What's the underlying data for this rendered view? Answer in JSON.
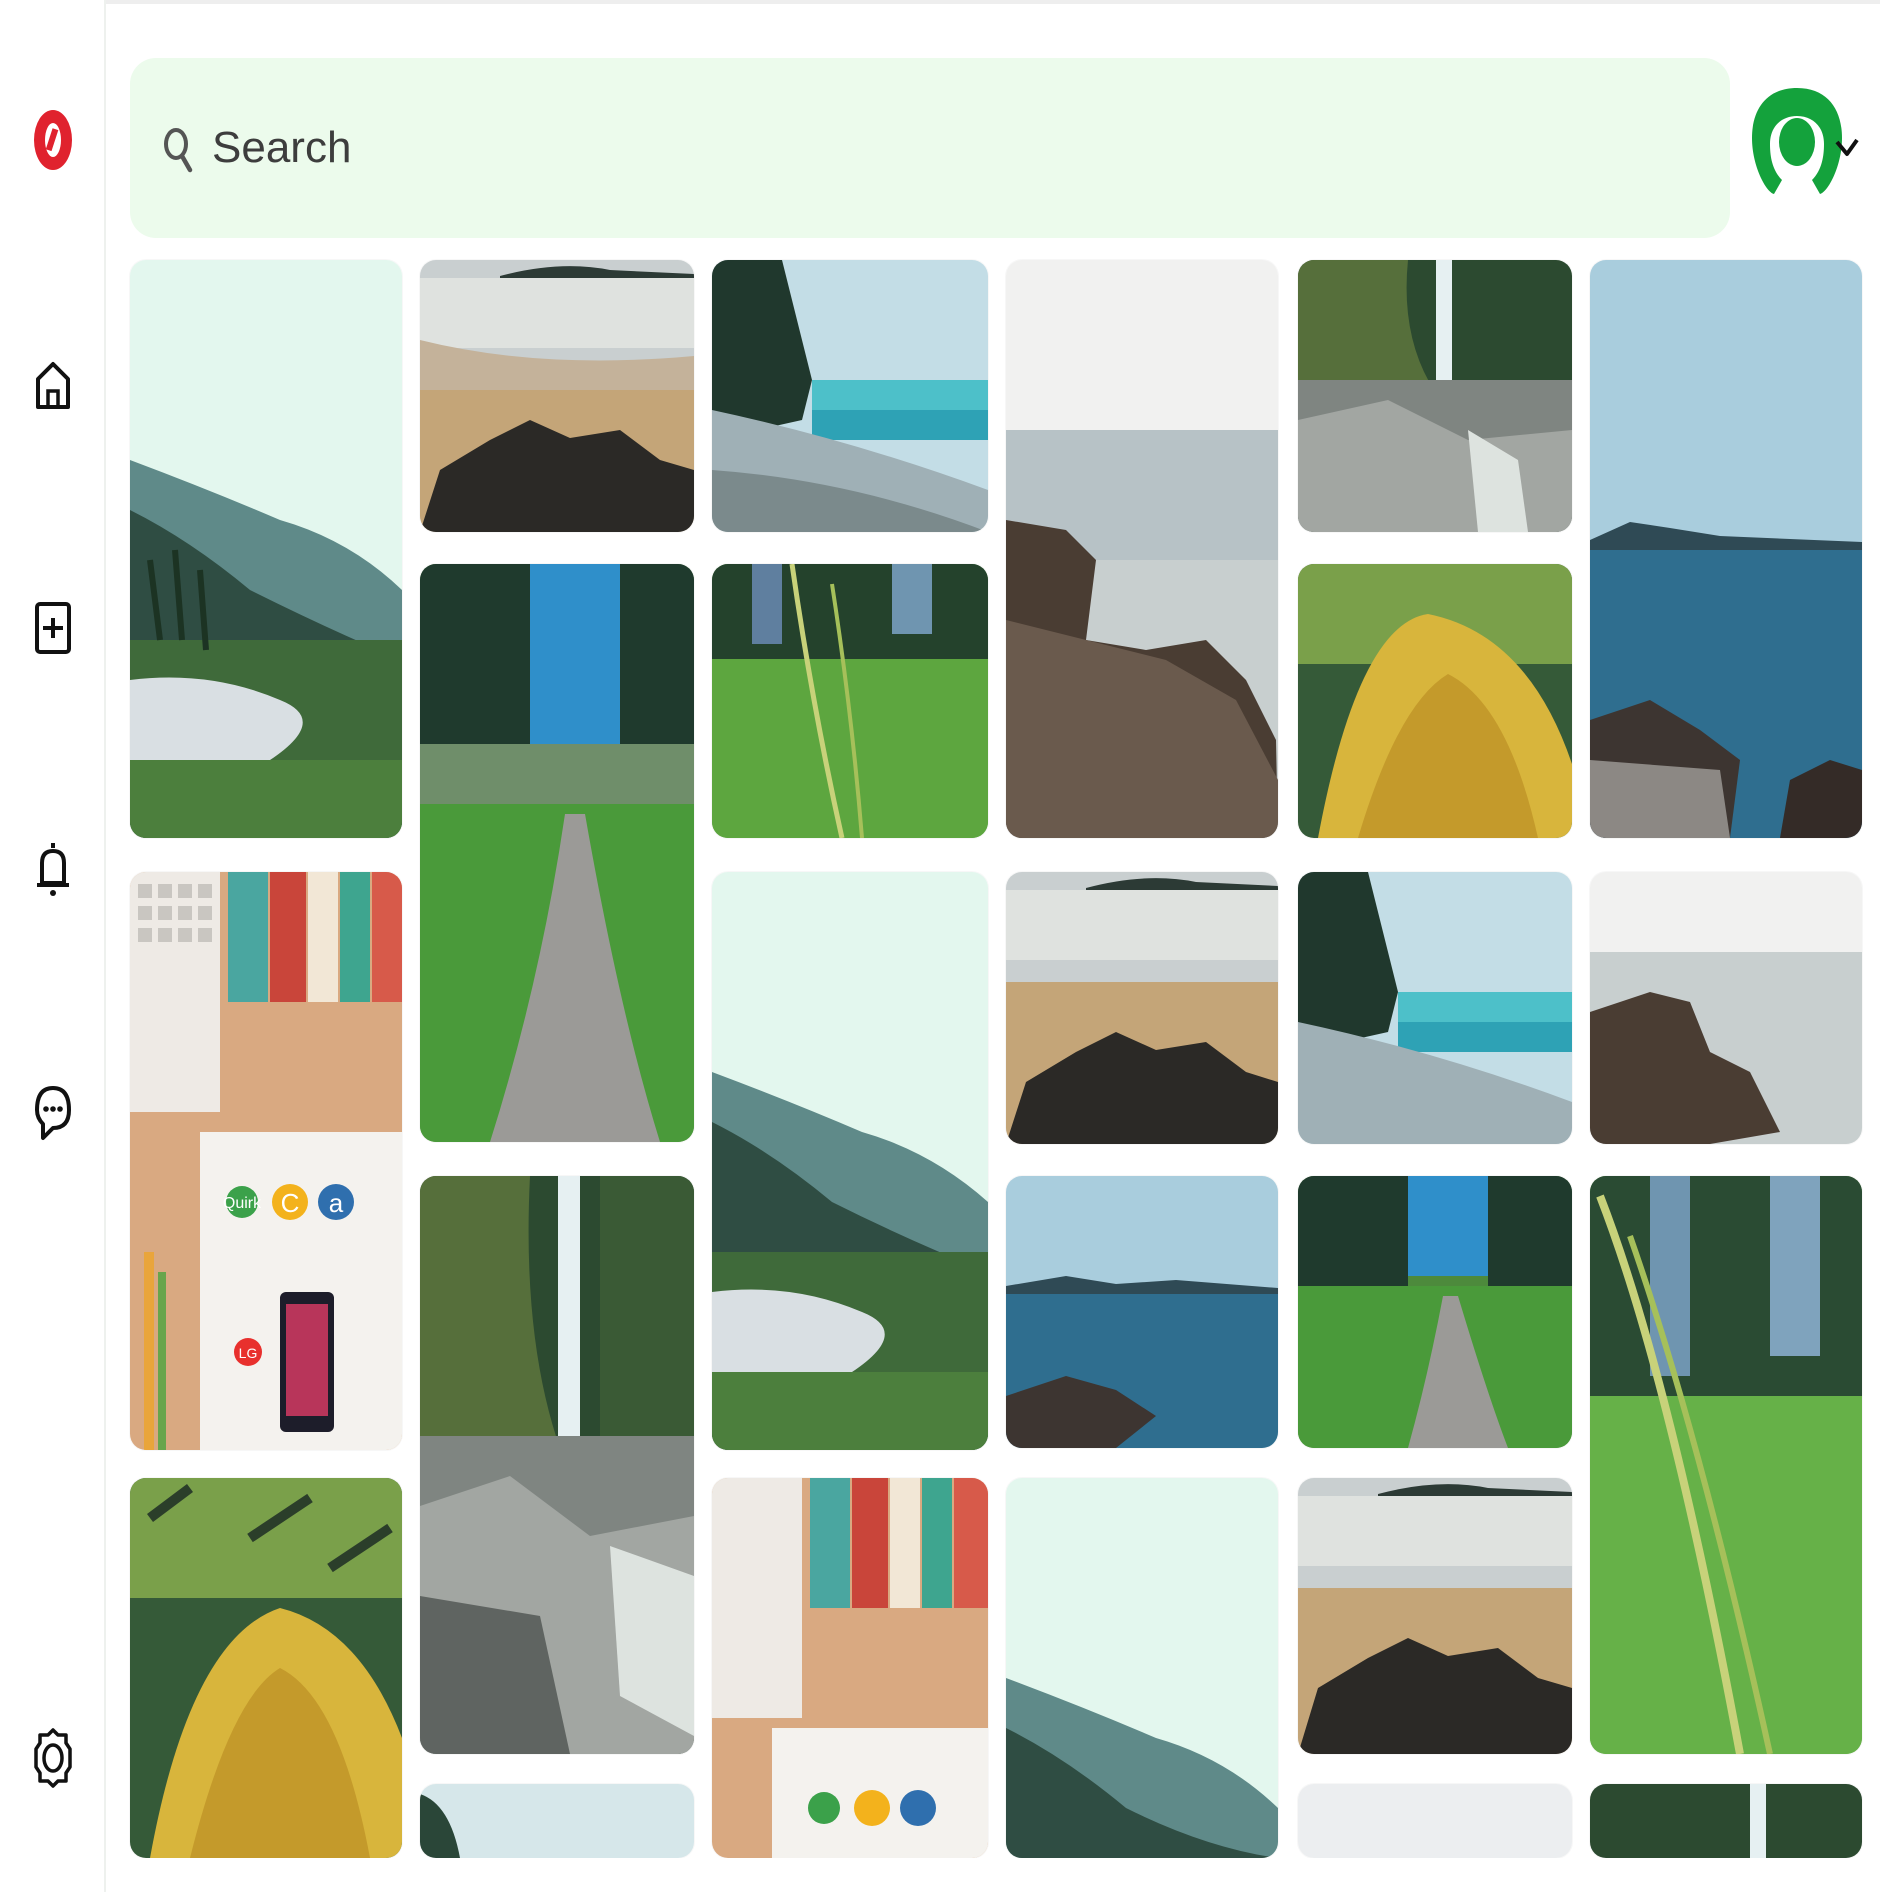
{
  "app": {
    "logo": "red-ring-logo",
    "brand_color": "#e0222e",
    "accent_color": "#14a23c"
  },
  "sidebar": {
    "items": [
      {
        "icon": "home-icon"
      },
      {
        "icon": "add-square-icon"
      },
      {
        "icon": "bell-icon"
      },
      {
        "icon": "chat-bubble-icon"
      },
      {
        "icon": "settings-gear-icon"
      }
    ]
  },
  "search": {
    "placeholder": "Search",
    "value": "",
    "background": "#ecfbec"
  },
  "user": {
    "avatar_icon": "green-user-avatar",
    "menu_icon": "chevron-down-icon"
  },
  "feed": {
    "columns": [
      {
        "pins": [
          "misty-forest-estuary",
          "desk-books-apps",
          "yellow-flower-bush"
        ]
      },
      {
        "pins": [
          "sandy-beach-rocks",
          "forest-path",
          "waterfall-rocks",
          "misty-cove"
        ]
      },
      {
        "pins": [
          "coastal-forest-beach",
          "grass-meadow",
          "misty-forest-estuary",
          "desk-books-apps"
        ]
      },
      {
        "pins": [
          "rocky-shore-sea",
          "sandy-beach-rocks",
          "blue-sea-island",
          "misty-forest-estuary"
        ]
      },
      {
        "pins": [
          "waterfall-rocks",
          "yellow-flower-bush",
          "coastal-forest-beach",
          "forest-path",
          "sandy-beach-rocks",
          "pale-sky"
        ]
      },
      {
        "pins": [
          "blue-sea-island",
          "rocky-shore-sea",
          "grass-meadow",
          "waterfall-rocks"
        ]
      }
    ]
  },
  "desk_app_labels": [
    "Quirk",
    "C",
    "a",
    "LG"
  ]
}
